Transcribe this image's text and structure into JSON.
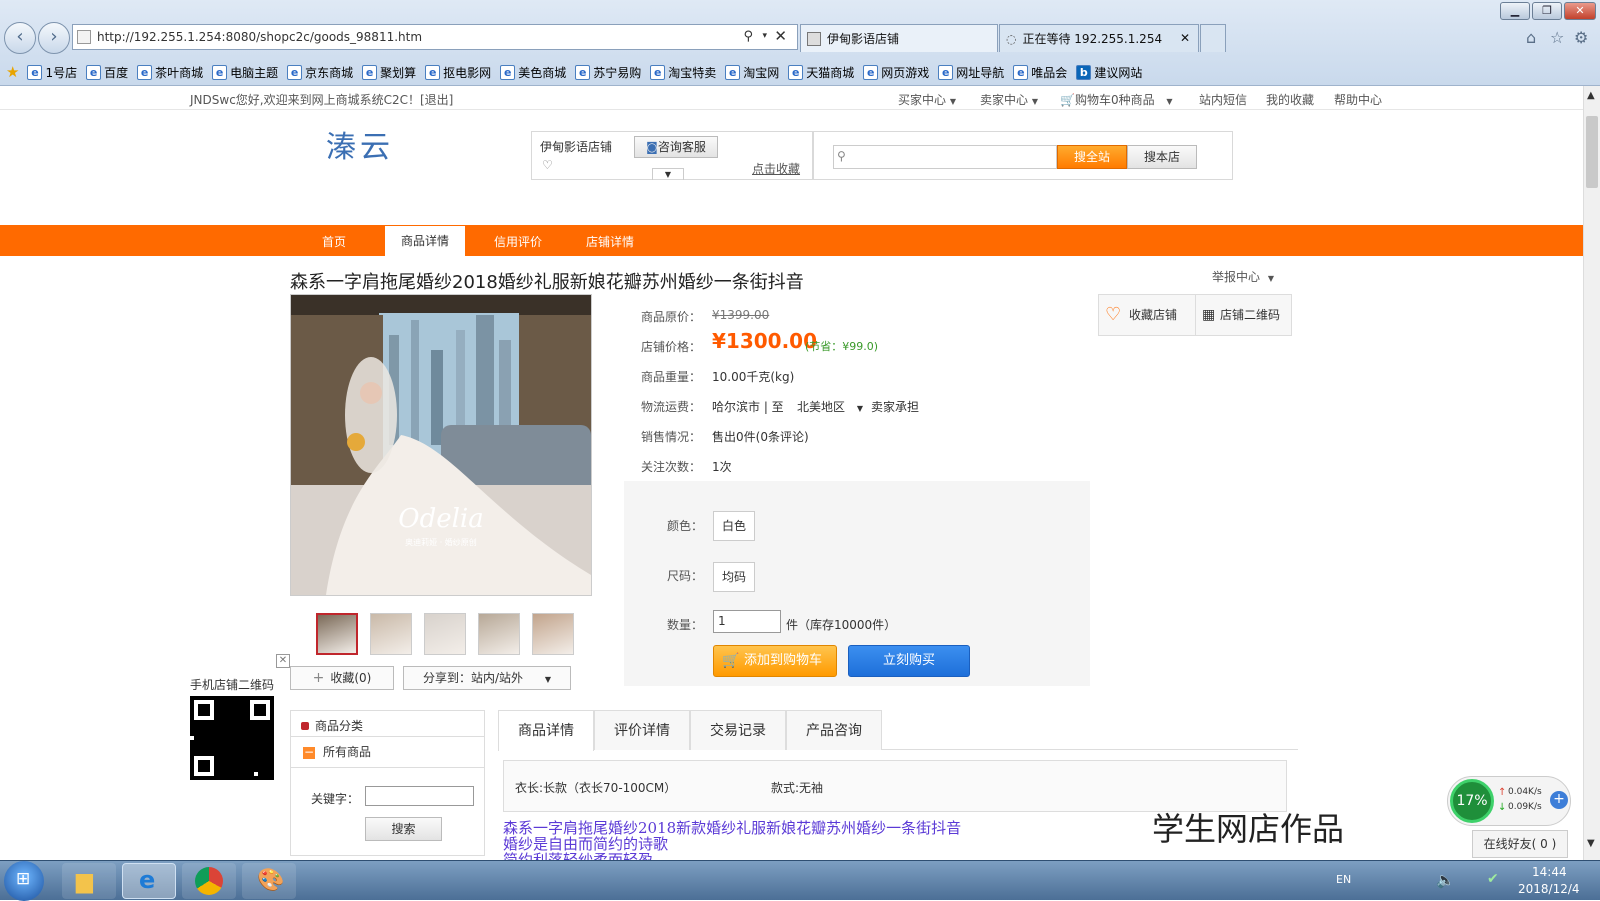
{
  "browser": {
    "address": "http://192.255.1.254:8080/shopc2c/goods_98811.htm",
    "tabs": [
      {
        "title": "伊甸影语店铺"
      },
      {
        "title": "正在等待 192.255.1.254"
      }
    ],
    "favorites": [
      "1号店",
      "百度",
      "茶叶商城",
      "电脑主题",
      "京东商城",
      "聚划算",
      "抠电影网",
      "美色商城",
      "苏宁易购",
      "淘宝特卖",
      "淘宝网",
      "天猫商城",
      "网页游戏",
      "网址导航",
      "唯品会",
      "建议网站"
    ]
  },
  "topbar": {
    "welcome": "JNDSwc您好,欢迎来到网上商城系统C2C！[退出]",
    "buyer": "买家中心",
    "seller": "卖家中心",
    "cart": "购物车0种商品",
    "msg": "站内短信",
    "fav": "我的收藏",
    "help": "帮助中心"
  },
  "header": {
    "logo": "溱云",
    "store_name": "伊甸影语店铺",
    "consult": "咨询客服",
    "collect": "点击收藏",
    "search_all": "搜全站",
    "search_store": "搜本店"
  },
  "nav": {
    "home": "首页",
    "detail": "商品详情",
    "credit": "信用评价",
    "store": "店铺详情"
  },
  "product": {
    "title": "森系一字肩拖尾婚纱2018婚纱礼服新娘花瓣苏州婚纱一条街抖音",
    "report": "举报中心",
    "orig_label": "商品原价：",
    "orig_price": "¥1399.00",
    "price_label": "店铺价格：",
    "price": "¥1300.00",
    "save": "(节省：¥99.0)",
    "weight_label": "商品重量：",
    "weight": "10.00千克(kg)",
    "ship_label": "物流运费：",
    "ship_from": "哈尔滨市 | 至",
    "ship_to": "北美地区",
    "ship_note": "卖家承担",
    "sales_label": "销售情况：",
    "sales": "售出0件(0条评论)",
    "follow_label": "关注次数：",
    "follow": "1次",
    "color_label": "颜色：",
    "color": "白色",
    "size_label": "尺码：",
    "size": "均码",
    "qty_label": "数量：",
    "qty": "1",
    "stock": "件（库存10000件）",
    "add_cart": "添加到购物车",
    "buy_now": "立刻购买",
    "watermark": "Odelia",
    "watermark_sub": "奥迪莉娅 · 婚纱原创"
  },
  "side": {
    "fav_store": "收藏店铺",
    "qr": "店铺二维码",
    "mobile_qr": "手机店铺二维码",
    "collect_count": "收藏(0)",
    "share": "分享到：站内/站外"
  },
  "category": {
    "title": "商品分类",
    "all": "所有商品",
    "keyword": "关键字：",
    "search": "搜索"
  },
  "tabs": [
    "商品详情",
    "评价详情",
    "交易记录",
    "产品咨询"
  ],
  "attrs": {
    "length": "衣长:长款（衣长70-100CM）",
    "style": "款式:无袖"
  },
  "desc": {
    "line1": "森系一字肩拖尾婚纱2018新款婚纱礼服新娘花瓣苏州婚纱一条街抖音",
    "line2": "婚纱是自由而简约的诗歌",
    "line3": "简约利落轻纱柔而轻盈"
  },
  "overlay": {
    "banner": "学生网店作品",
    "net_pct": "17%",
    "up": "0.04K/s",
    "down": "0.09K/s",
    "online": "在线好友( 0 )"
  },
  "taskbar": {
    "lang": "EN",
    "time": "14:44",
    "date": "2018/12/4"
  },
  "colors": {
    "accent": "#ff6a00",
    "price": "#ff5a00",
    "buy_blue": "#1e6fd9"
  }
}
